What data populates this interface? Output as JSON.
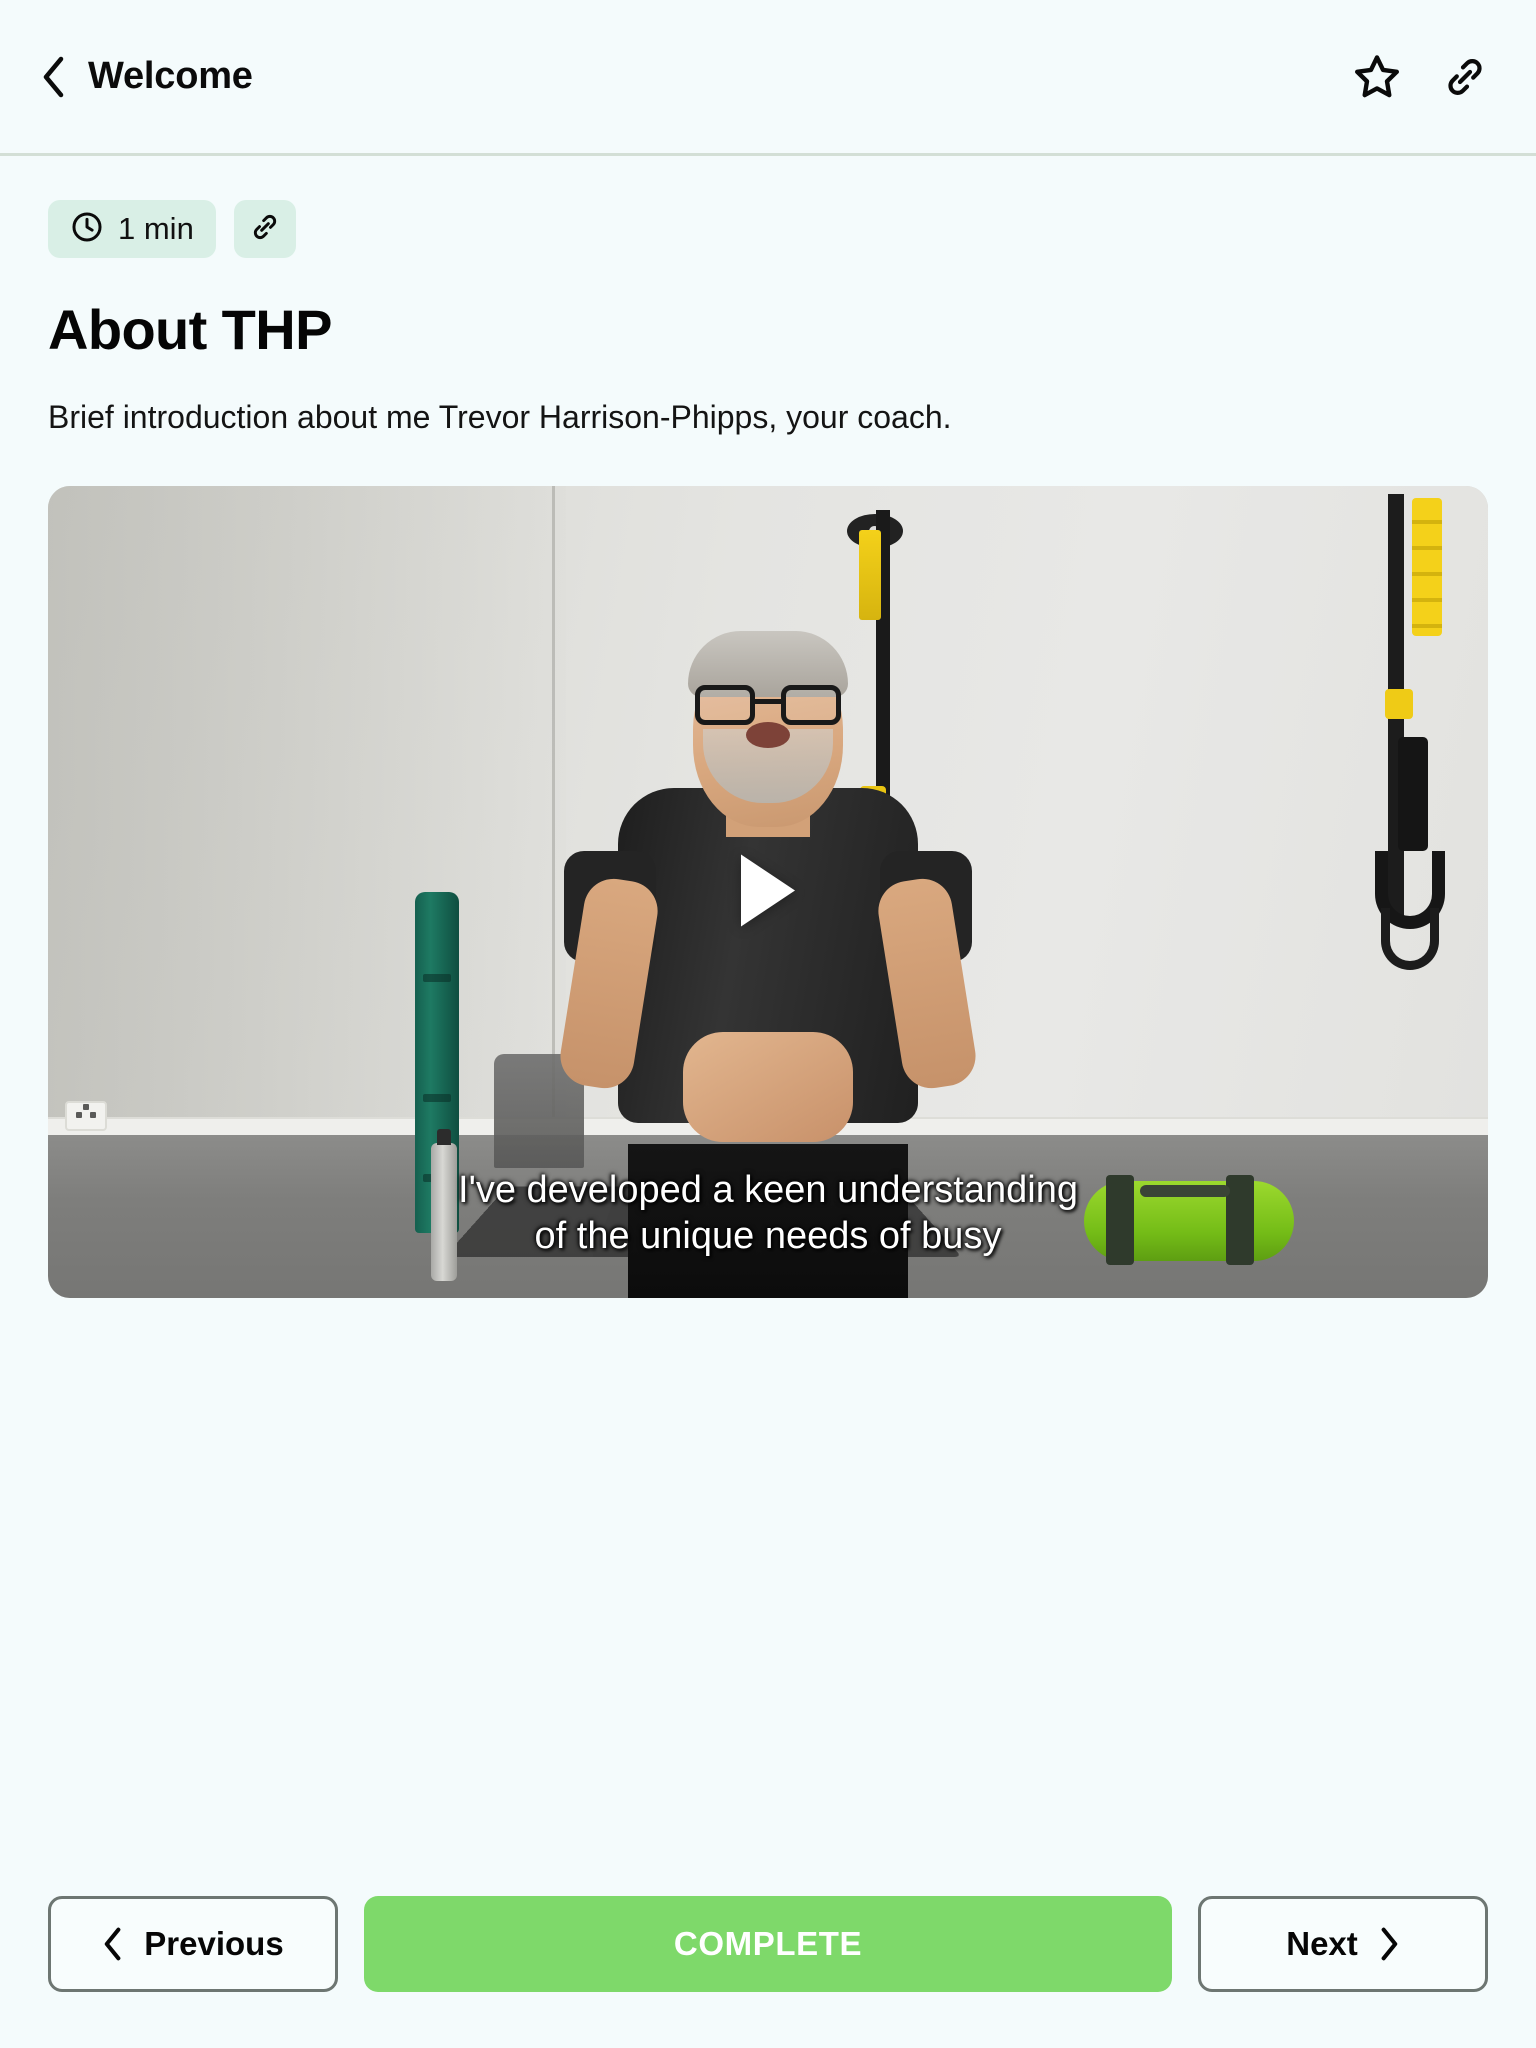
{
  "header": {
    "back_label": "Welcome",
    "back_icon": "chevron-left-icon",
    "favorite_icon": "star-icon",
    "share_icon": "link-icon"
  },
  "lesson": {
    "duration_badge": {
      "icon": "clock-icon",
      "text": "1 min"
    },
    "link_badge": {
      "icon": "link-icon"
    },
    "title": "About THP",
    "description": "Brief introduction about me Trevor Harrison-Phipps, your coach."
  },
  "video": {
    "play_icon": "play-icon",
    "caption_line_1": "I've developed a keen understanding",
    "caption_line_2": "of the unique needs of busy"
  },
  "footer": {
    "previous_label": "Previous",
    "previous_icon": "chevron-left-icon",
    "complete_label": "COMPLETE",
    "next_label": "Next",
    "next_icon": "chevron-right-icon"
  },
  "colors": {
    "page_background": "#F4FBFC",
    "badge_background": "#D9EFE6",
    "primary_green": "#7ED96A",
    "divider": "#D3DFD6",
    "outline_border": "#6D7672"
  }
}
